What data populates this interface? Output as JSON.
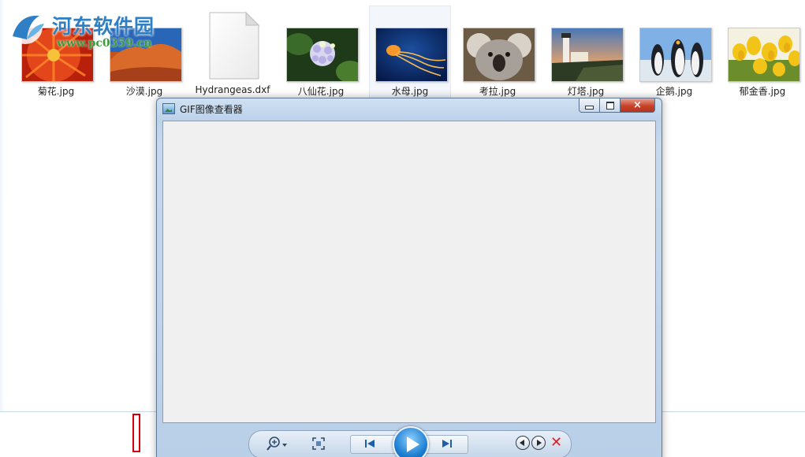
{
  "watermark": {
    "title": "河东软件园",
    "url": "www.pc0359.cn"
  },
  "files": [
    {
      "label": "菊花.jpg",
      "thumb": "chrysanthemum"
    },
    {
      "label": "沙漠.jpg",
      "thumb": "desert"
    },
    {
      "label": "Hydrangeas.dxf",
      "thumb": "document"
    },
    {
      "label": "八仙花.jpg",
      "thumb": "hydrangea"
    },
    {
      "label": "水母.jpg",
      "thumb": "jellyfish",
      "selected": true
    },
    {
      "label": "考拉.jpg",
      "thumb": "koala"
    },
    {
      "label": "灯塔.jpg",
      "thumb": "lighthouse"
    },
    {
      "label": "企鹅.jpg",
      "thumb": "penguins"
    },
    {
      "label": "郁金香.jpg",
      "thumb": "tulips"
    }
  ],
  "viewer": {
    "title": "GIF图像查看器",
    "controls": {
      "minimize": "minimize-icon",
      "maximize": "maximize-icon",
      "close": "×"
    },
    "toolbar": {
      "zoom": "zoom-icon",
      "fit": "fit-to-window-icon",
      "previous": "previous-icon",
      "play": "play-icon",
      "next": "next-icon",
      "rotate_left": "rotate-left-icon",
      "rotate_right": "rotate-right-icon",
      "delete": "✕"
    }
  },
  "colors": {
    "accent": "#2e7fc3",
    "close_red": "#c7432b",
    "play_blue": "#1f7fd1"
  }
}
